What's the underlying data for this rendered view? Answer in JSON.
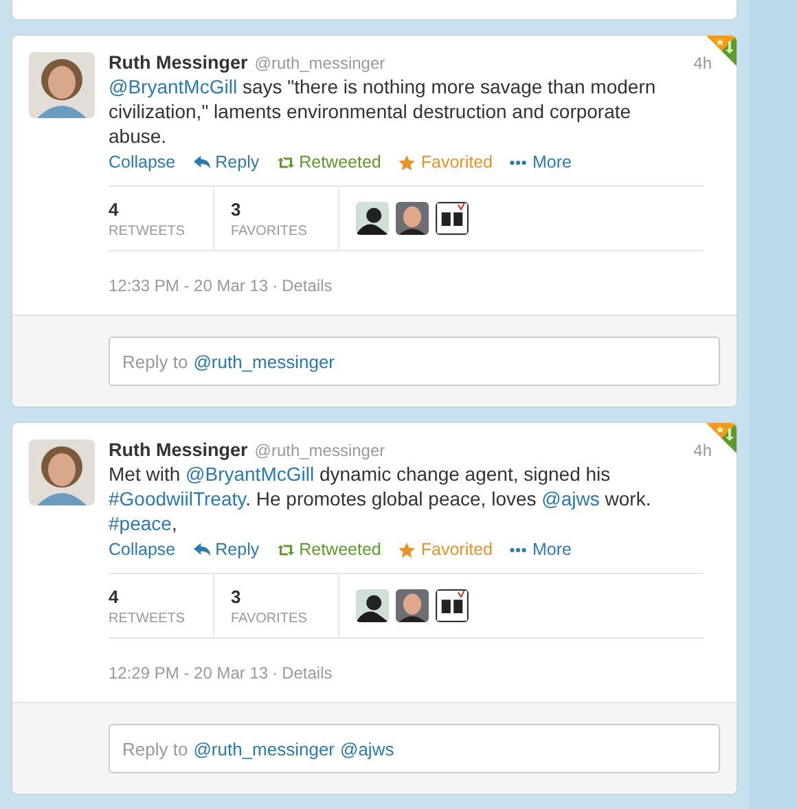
{
  "tweets": [
    {
      "name": "Ruth Messinger",
      "handle": "@ruth_messinger",
      "time": "4h",
      "text": [
        {
          "text": "@BryantMcGill",
          "link": true
        },
        {
          "text": " says \"there is nothing more savage than modern civilization,\" laments environmental destruction and corporate abuse.",
          "link": false
        }
      ],
      "actions": [
        {
          "kind": "collapse",
          "label": "Collapse",
          "on": false
        },
        {
          "kind": "reply",
          "label": "Reply",
          "on": false
        },
        {
          "kind": "retweet",
          "label": "Retweeted",
          "on": true
        },
        {
          "kind": "favorite",
          "label": "Favorited",
          "on": true
        },
        {
          "kind": "more",
          "label": "More",
          "on": false
        }
      ],
      "stats": [
        {
          "count": "4",
          "label": "RETWEETS"
        },
        {
          "count": "3",
          "label": "FAVORITES"
        }
      ],
      "timestamp": "12:33 PM - 20 Mar 13",
      "separator": "·",
      "details": "Details",
      "reply_box": {
        "prefix": "Reply to",
        "mentions": [
          "@ruth_messinger"
        ]
      }
    },
    {
      "name": "Ruth Messinger",
      "handle": "@ruth_messinger",
      "time": "4h",
      "text": [
        {
          "text": "Met with ",
          "link": false
        },
        {
          "text": "@BryantMcGill",
          "link": true
        },
        {
          "text": " dynamic change agent, signed his ",
          "link": false
        },
        {
          "text": "#GoodwiilTreaty",
          "link": true
        },
        {
          "text": ". He promotes global peace, loves ",
          "link": false
        },
        {
          "text": "@ajws",
          "link": true
        },
        {
          "text": " work. ",
          "link": false
        },
        {
          "text": "#peace",
          "link": true
        },
        {
          "text": ",",
          "link": false
        }
      ],
      "actions": [
        {
          "kind": "collapse",
          "label": "Collapse",
          "on": false
        },
        {
          "kind": "reply",
          "label": "Reply",
          "on": false
        },
        {
          "kind": "retweet",
          "label": "Retweeted",
          "on": true
        },
        {
          "kind": "favorite",
          "label": "Favorited",
          "on": true
        },
        {
          "kind": "more",
          "label": "More",
          "on": false
        }
      ],
      "stats": [
        {
          "count": "4",
          "label": "RETWEETS"
        },
        {
          "count": "3",
          "label": "FAVORITES"
        }
      ],
      "timestamp": "12:29 PM - 20 Mar 13",
      "separator": "·",
      "details": "Details",
      "reply_box": {
        "prefix": "Reply to",
        "mentions": [
          "@ruth_messinger",
          "@ajws"
        ]
      }
    }
  ]
}
